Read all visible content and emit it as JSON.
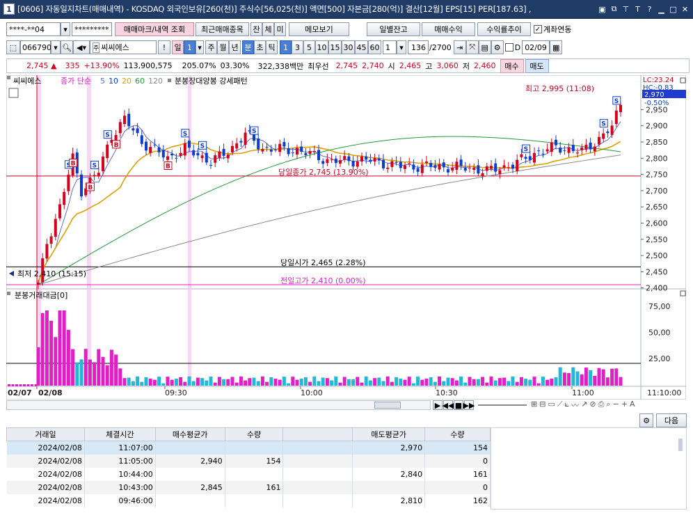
{
  "title": {
    "number": "1",
    "text": "[0606] 자동일지차트(매매내역) - KOSDAQ 외국인보유[260(천)] 주식수[56,025(천)] 액면[500] 자본금[280(억)] 결산[12월] EPS[15] PER[187.63] ,"
  },
  "toolbar1": {
    "account": "****-**04",
    "password": "*********",
    "mark_btn": "매매마크/내역 조회",
    "recent_btn": "최근매매종목",
    "b1": "잔",
    "b2": "체",
    "b3": "미",
    "memo_btn": "메모보기",
    "daily_btn": "일별잔고",
    "profit_btn": "매매수익",
    "rate_btn": "수익률추이",
    "link_label": "계좌연동"
  },
  "toolbar2": {
    "code": "066790",
    "stock_name": "씨씨에스",
    "exclaim": "!",
    "period_day": "일",
    "period_val": "1",
    "w": "주",
    "m": "월",
    "y": "년",
    "minute": "분",
    "sec": "초",
    "tick": "틱",
    "intervals": [
      "1",
      "3",
      "5",
      "10",
      "15",
      "30",
      "45",
      "60"
    ],
    "interval_custom": "1",
    "count": "136",
    "total": "/2700",
    "d_label": "D",
    "date": "02/09"
  },
  "quote": {
    "price": "2,745 ▲",
    "change": "335",
    "change_pct": "+13.90%",
    "volume": "113,900,575",
    "vol_ratio": "205.07%",
    "turnover": "03.30%",
    "amount": "322,338백만",
    "best_label": "최우선",
    "ask1": "2,745",
    "bid1": "2,740",
    "open_label": "시",
    "open": "2,465",
    "high_label": "고",
    "high": "3,060",
    "low_label": "저",
    "low": "2,460",
    "buy_btn": "매수",
    "sell_btn": "매도"
  },
  "chart_legend": {
    "name": "씨씨에스",
    "ma_label": "종가 단순",
    "ma_vals": [
      "5",
      "10",
      "20",
      "60",
      "120"
    ],
    "pattern": "분봉장대양봉 강세패턴"
  },
  "annotations": {
    "high_note": "최고 2,995 (11:08)",
    "low_note": "최저 2,410 (15:15)",
    "cur_note": "당일종가 2,745 (13.90%)",
    "open_note": "당일시가 2,465 (2.28%)",
    "prev_note": "전일고가 2,410 (0.00%)",
    "lc": "LC:23.24",
    "hc": "HC:-0.83",
    "cur_tag": "2,970",
    "pct_tag": "-0.50%"
  },
  "y_axis": [
    "2,950",
    "2,900",
    "2,850",
    "2,800",
    "2,750",
    "2,700",
    "2,650",
    "2,600",
    "2,550",
    "2,500",
    "2,450",
    "2,400"
  ],
  "volume_panel": {
    "title": "분봉거래대금[0]",
    "axis": [
      "75,00",
      "50,00",
      "25,00"
    ]
  },
  "x_axis": {
    "labels": [
      "02/07",
      "02/08",
      "09:30",
      "10:00",
      "10:30",
      "11:00",
      "11:10:00"
    ]
  },
  "colors": {
    "up": "#d4001c",
    "down": "#0b3ccf",
    "vol_up": "#e21fc7",
    "vol_down": "#22b8d8",
    "ma5": "#5c6cd8",
    "ma20": "#e0a000",
    "ma60": "#1f9a3a",
    "ma120": "#8a8a8a"
  },
  "panel_btns": {
    "next": "다음"
  },
  "table": {
    "headers": [
      "거래일",
      "체결시간",
      "매수평균가",
      "수량",
      "",
      "매도평균가",
      "수량"
    ],
    "rows": [
      [
        "2024/02/08",
        "11:07:00",
        "",
        "",
        "",
        "2,970",
        "154"
      ],
      [
        "2024/02/08",
        "11:05:00",
        "2,940",
        "154",
        "",
        "",
        "0"
      ],
      [
        "2024/02/08",
        "10:44:00",
        "",
        "",
        "",
        "2,840",
        "161"
      ],
      [
        "2024/02/08",
        "10:43:00",
        "2,845",
        "161",
        "",
        "",
        "0"
      ],
      [
        "2024/02/08",
        "09:46:00",
        "",
        "",
        "",
        "2,810",
        "162"
      ]
    ]
  }
}
